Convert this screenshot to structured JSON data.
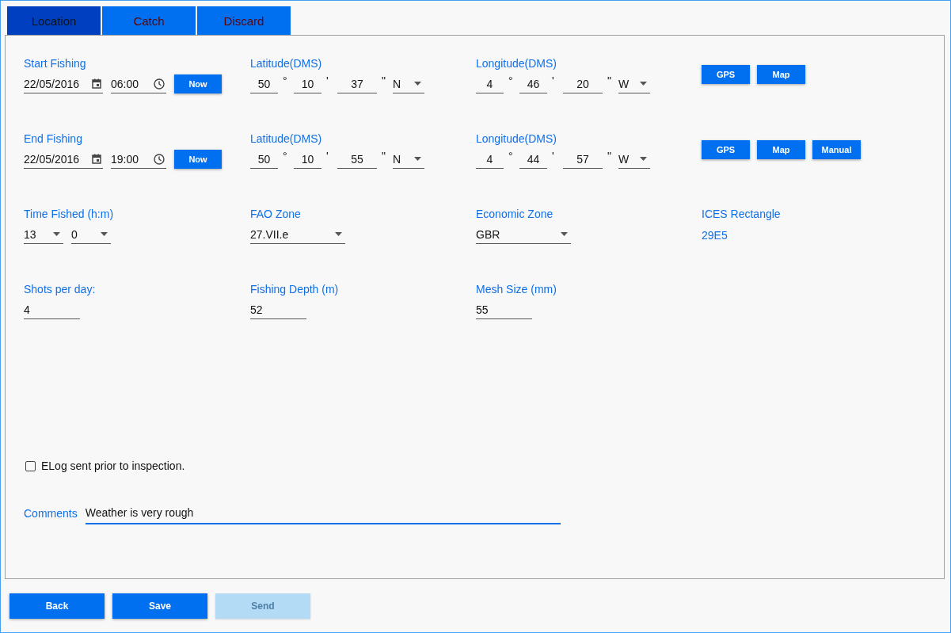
{
  "tabs": [
    {
      "label": "Location",
      "selected": true
    },
    {
      "label": "Catch",
      "selected": false
    },
    {
      "label": "Discard",
      "selected": false
    }
  ],
  "fishing_periods": [
    {
      "label": "Start Fishing",
      "date": "22/05/2016",
      "time": "06:00",
      "now_button": "Now",
      "latitude": {
        "label": "Latitude(DMS)",
        "degrees": "50",
        "degree_mark": "°",
        "minutes": "10",
        "minute_mark": "'",
        "seconds": "37",
        "second_mark": "\"",
        "hemisphere": "N"
      },
      "longitude": {
        "label": "Longitude(DMS)",
        "degrees": "4",
        "degree_mark": "°",
        "minutes": "46",
        "minute_mark": "'",
        "seconds": "20",
        "second_mark": "\"",
        "hemisphere": "W"
      },
      "buttons": [
        "GPS",
        "Map"
      ]
    },
    {
      "label": "End Fishing",
      "date": "22/05/2016",
      "time": "19:00",
      "now_button": "Now",
      "latitude": {
        "label": "Latitude(DMS)",
        "degrees": "50",
        "degree_mark": "°",
        "minutes": "10",
        "minute_mark": "'",
        "seconds": "55",
        "second_mark": "\"",
        "hemisphere": "N"
      },
      "longitude": {
        "label": "Longitude(DMS)",
        "degrees": "4",
        "degree_mark": "°",
        "minutes": "44",
        "minute_mark": "'",
        "seconds": "57",
        "second_mark": "\"",
        "hemisphere": "W"
      },
      "buttons": [
        "GPS",
        "Map",
        "Manual"
      ]
    }
  ],
  "time_fished": {
    "label": "Time Fished (h:m)",
    "hours": "13",
    "minutes": "0"
  },
  "fao_zone": {
    "label": "FAO Zone",
    "value": "27.VII.e"
  },
  "economic_zone": {
    "label": "Economic Zone",
    "value": "GBR"
  },
  "ices_rectangle": {
    "label": "ICES Rectangle",
    "value": "29E5"
  },
  "measures": [
    {
      "label": "Shots per day:",
      "value": "4"
    },
    {
      "label": "Fishing Depth (m)",
      "value": "52"
    },
    {
      "label": "Mesh Size (mm)",
      "value": "55"
    }
  ],
  "elog": {
    "label": "ELog sent prior to inspection.",
    "checked": false
  },
  "comments": {
    "label": "Comments",
    "value": "Weather is very rough"
  },
  "footer_buttons": [
    {
      "label": "Back",
      "disabled": false
    },
    {
      "label": "Save",
      "disabled": false
    },
    {
      "label": "Send",
      "disabled": true
    }
  ]
}
